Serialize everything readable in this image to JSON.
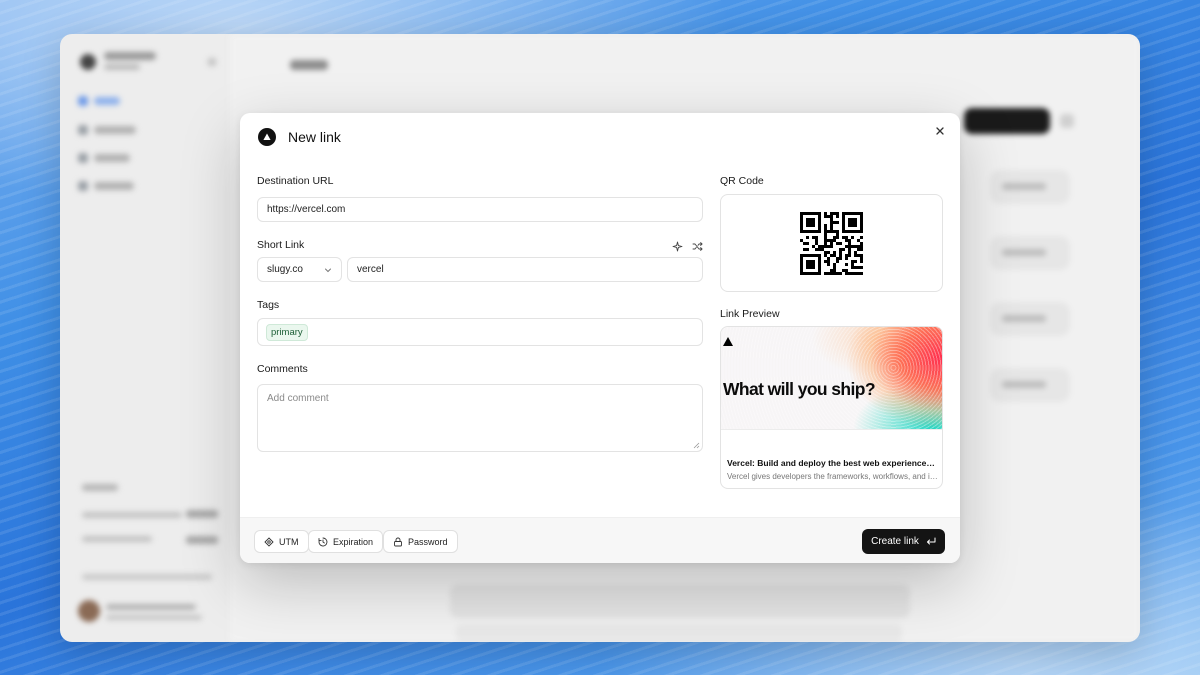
{
  "modal": {
    "title": "New link",
    "destination": {
      "label": "Destination URL",
      "value": "https://vercel.com"
    },
    "short_link": {
      "label": "Short Link",
      "domain": "slugy.co",
      "slug": "vercel"
    },
    "tags": {
      "label": "Tags",
      "items": [
        "primary"
      ]
    },
    "comments": {
      "label": "Comments",
      "placeholder": "Add comment"
    },
    "qr": {
      "label": "QR Code"
    },
    "preview": {
      "label": "Link Preview",
      "headline": "What will you ship?",
      "title": "Vercel: Build and deploy the best web experiences with the Frontend Cloud",
      "description": "Vercel gives developers the frameworks, workflows, and infrastructure to build a faster, more personalized web."
    },
    "footer": {
      "utm_label": "UTM",
      "expiration_label": "Expiration",
      "password_label": "Password",
      "create_label": "Create link"
    }
  },
  "colors": {
    "primary_button": "#141414",
    "tag_background": "#eaf7ee",
    "tag_text": "#1c5e36"
  }
}
